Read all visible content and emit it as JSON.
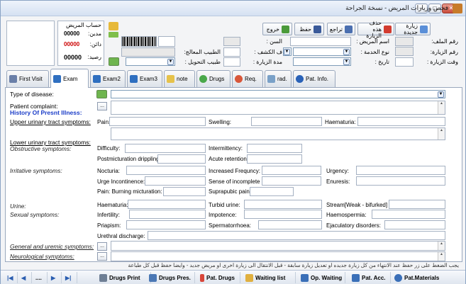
{
  "window": {
    "title": "فحص وزيارات المريض - نسخة الجراحة"
  },
  "account": {
    "title": "حساب المريض",
    "debit_label": "مدين:",
    "debit": "00000",
    "credit_label": "دائن:",
    "credit": "00000",
    "balance_label": "رصيد:",
    "balance": "00000"
  },
  "toolbar": {
    "new_visit": "زيارة جديدة",
    "delete_visit": "حذف هذه الزيارة",
    "undo": "تراجع",
    "save": "حفظ",
    "exit": "خروج"
  },
  "fields": {
    "file_no": "رقم الملف:",
    "visit_no": "رقم الزيارة:",
    "visit_time": "وقت الزيارة :",
    "patient_name": "اسم المريض :",
    "service_type": "نوع الخدمة :",
    "date": "تاريخ :",
    "age": "السن :",
    "exam_fee": "ف الكشف :",
    "visit_duration": "مدة الزيارة :",
    "treating_doctor": "الطبيب المعالج:",
    "referring_doctor": "طبيب التحويل :"
  },
  "tabs": [
    {
      "label": "First Visit"
    },
    {
      "label": "Exam"
    },
    {
      "label": "Exam2"
    },
    {
      "label": "Exam3"
    },
    {
      "label": "note"
    },
    {
      "label": "Drugs"
    },
    {
      "label": "Req."
    },
    {
      "label": "rad."
    },
    {
      "label": "Pat. Info."
    }
  ],
  "exam": {
    "type_of_disease": "Type of disease:",
    "patient_complaint": "Patient complaint:",
    "history": "History Of Presnt Illness:",
    "upper_urinary": "Upper urinary tract symptoms:",
    "pain": "Pain:",
    "swelling": "Swelling:",
    "haematuria": "Haematuria:",
    "lower_urinary": "Lower urinary tract symptoms:",
    "obstructive": "Obstructive symptoms:",
    "difficulty": "Difficulty:",
    "intermittency": "Intermittency:",
    "postmicturation": "Postmicturation drippling:",
    "acute_retention": "Acute retention:",
    "irritative": "Irritative symptoms:",
    "nocturia": "Nocturia:",
    "increased_frequency": "Increased Frequncy:",
    "urgency": "Urgency:",
    "urge_incontinence": "Urge Incontinence:",
    "incomplete_emptying": "Sense of incomplete emptyin",
    "enuresis": "Enuresis:",
    "pain_burning": "Pain:  Burning micturation:",
    "suprapubic": "Suprapubic pain:",
    "urine": "Urine:",
    "haematuria2": "Haematuria:",
    "turbid_urine": "Turbid urine:",
    "stream": "Stream[Weak - bifurked]",
    "sexual": "Sexual symptoms:",
    "infertility": "Infertility:",
    "impotence": "Impotence:",
    "haemospermia": "Haemospermia:",
    "priapism": "Priapism:",
    "spermatorrhoea": "Spermatorrhoea:",
    "ejaculatory": "Ejaculatory disorders:",
    "urethral": "Urethral discharge:",
    "general": "General and uremic symptoms:",
    "neurological": "Neurological symptoms:"
  },
  "status_note": "يجب الضغط على زر حفظ عند الانتهاء من كل زيارة جديده او تعديل زيارة سابقة - قبل الانتقال الى زيارة اخرى او مريض جديد - وايضا حفظ قبل كل طباعة",
  "bottom": {
    "nav_dots": "....",
    "drugs_print": "Drugs Print",
    "drugs_pres": "Drugs Pres.",
    "pat_drugs": "Pat. Drugs",
    "waiting_list": "Waiting list",
    "op_waiting": "Op. Waiting",
    "pat_acc": "Pat. Acc.",
    "pat_materials": "Pat.Materials"
  }
}
